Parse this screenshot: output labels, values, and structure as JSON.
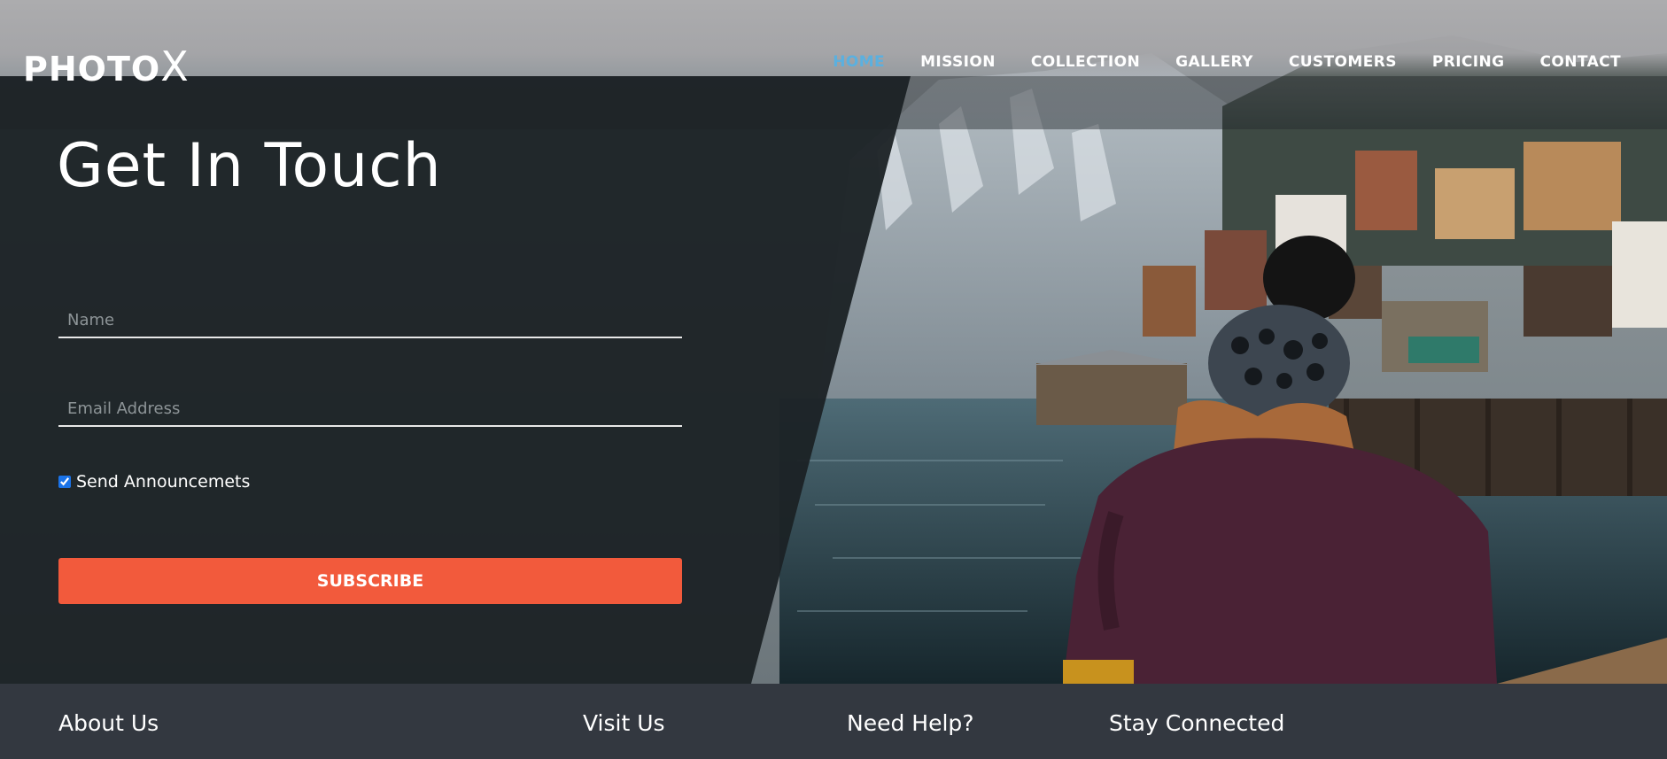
{
  "brand": {
    "name": "PHOTO",
    "accent_letter": "X"
  },
  "nav": {
    "items": [
      {
        "label": "HOME",
        "active": true
      },
      {
        "label": "MISSION"
      },
      {
        "label": "COLLECTION"
      },
      {
        "label": "GALLERY"
      },
      {
        "label": "CUSTOMERS"
      },
      {
        "label": "PRICING"
      },
      {
        "label": "CONTACT"
      }
    ]
  },
  "form": {
    "title": "Get In Touch",
    "name_placeholder": "Name",
    "email_placeholder": "Email Address",
    "checkbox_label": "Send Announcemets",
    "checkbox_checked": true,
    "subscribe_label": "SUBSCRIBE"
  },
  "footer": {
    "about": "About Us",
    "visit": "Visit Us",
    "help": "Need Help?",
    "connected": "Stay Connected"
  },
  "colors": {
    "accent_nav": "#5bb0df",
    "subscribe_bg": "#f25a3c",
    "footer_bg": "#333840",
    "panel_bg": "#1e2628"
  }
}
